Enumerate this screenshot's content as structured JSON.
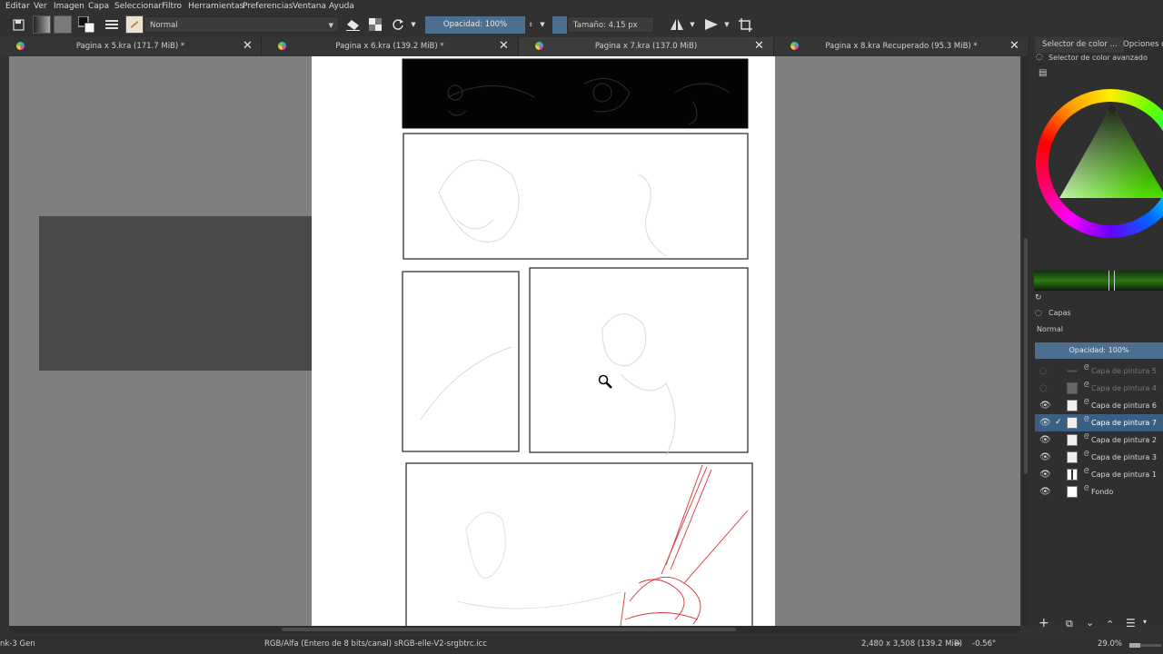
{
  "menu": [
    "Editar",
    "Ver",
    "Imagen",
    "Capa",
    "Seleccionar",
    "Filtro",
    "Herramientas",
    "Preferencias",
    "Ventana",
    "Ayuda"
  ],
  "toolbar": {
    "blend_mode": "Normal",
    "opacity": "Opacidad: 100%",
    "size": "Tamaño: 4.15 px"
  },
  "tabs": [
    {
      "label": "Pagina x 5.kra (171.7 MiB) *"
    },
    {
      "label": "Pagina x 6.kra (139.2 MiB) *"
    },
    {
      "label": "Pagina x 7.kra (137.0 MiB)"
    },
    {
      "label": "Pagina x 8.kra Recuperado (95.3 MiB) *"
    }
  ],
  "dock": {
    "tab1": "Selector de color ...",
    "tab2": "Opciones de",
    "color_selector_title": "Selector de color avanzado",
    "layers_title": "Capas",
    "layer_blend": "Normal",
    "layer_opacity": "Opacidad:  100%",
    "layers": [
      {
        "name": "Capa de pintura 5",
        "visible": false
      },
      {
        "name": "Capa de pintura 4",
        "visible": false
      },
      {
        "name": "Capa de pintura 6",
        "visible": true
      },
      {
        "name": "Capa de pintura 7",
        "visible": true,
        "selected": true
      },
      {
        "name": "Capa de pintura 2",
        "visible": true
      },
      {
        "name": "Capa de pintura 3",
        "visible": true
      },
      {
        "name": "Capa de pintura 1",
        "visible": true
      },
      {
        "name": "Fondo",
        "visible": true
      }
    ]
  },
  "status": {
    "brush": "nk-3 Gen",
    "color_info": "RGB/Alfa (Entero de 8 bits/canal)  sRGB-elle-V2-srgbtrc.icc",
    "dimensions": "2,480 x 3,508 (139.2 MiB)",
    "rotation": "-0.56°",
    "zoom": "29.0%"
  },
  "colors": {
    "accent": "#4d6f8f",
    "selected_row": "#3b5f82"
  }
}
